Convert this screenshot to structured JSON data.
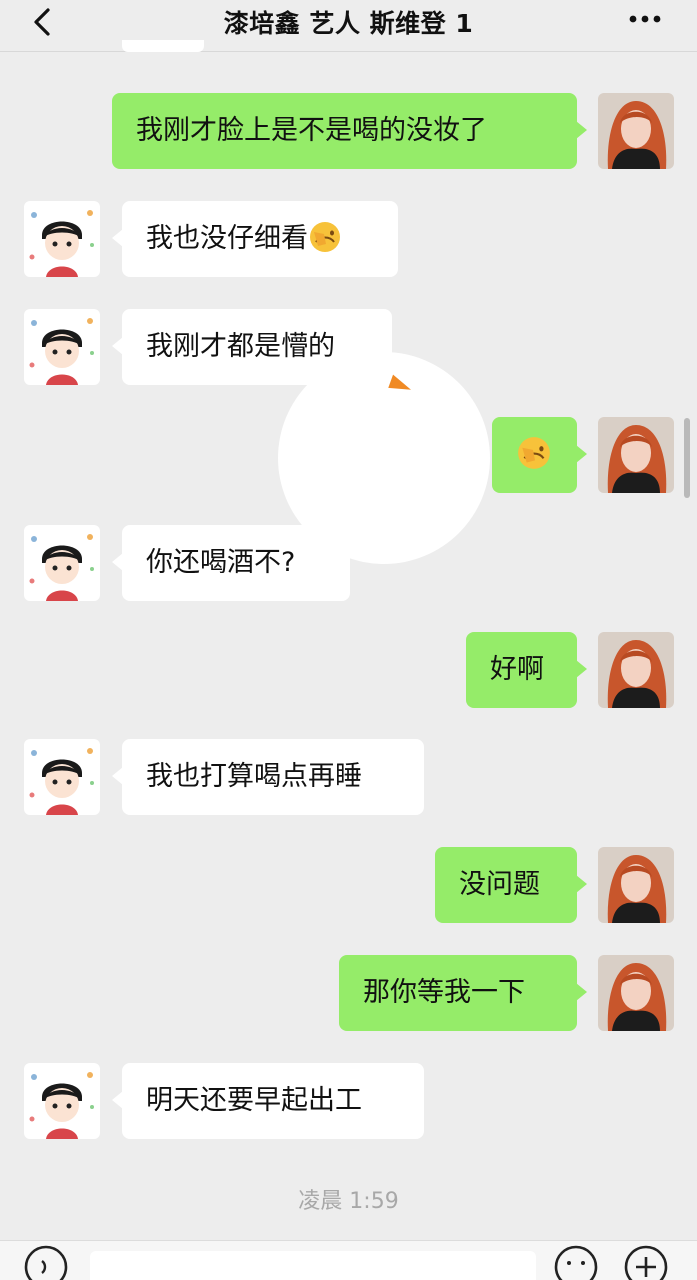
{
  "header": {
    "title": "漆培鑫 艺人 斯维登 1",
    "back_icon": "chevron-left-icon",
    "more_icon": "more-dots-icon"
  },
  "messages": [
    {
      "side": "me",
      "text": "我刚才脸上是不是喝的没妆了"
    },
    {
      "side": "other",
      "text": "我也没仔细看",
      "emoji": "facepalm-emoji"
    },
    {
      "side": "other",
      "text": "我刚才都是懵的"
    },
    {
      "side": "me",
      "text": "",
      "emoji": "facepalm-emoji"
    },
    {
      "side": "other",
      "text": "你还喝酒不?"
    },
    {
      "side": "me",
      "text": "好啊"
    },
    {
      "side": "other",
      "text": "我也打算喝点再睡"
    },
    {
      "side": "me",
      "text": "没问题"
    },
    {
      "side": "me",
      "text": "那你等我一下"
    },
    {
      "side": "other",
      "text": "明天还要早起出工"
    }
  ],
  "timestamp": "凌晨 1:59",
  "colors": {
    "background": "#ededed",
    "my_bubble": "#95ec69",
    "other_bubble": "#ffffff",
    "timestamp": "#a8a8a8"
  },
  "input_bar": {
    "voice_icon": "voice-icon",
    "emoji_icon": "emoji-icon",
    "plus_icon": "plus-icon"
  }
}
